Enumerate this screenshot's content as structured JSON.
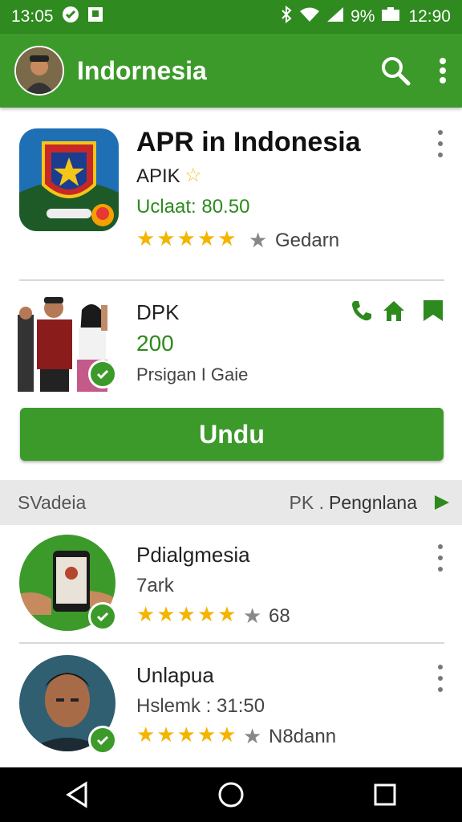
{
  "status_bar": {
    "time_left": "13:05",
    "battery": "9%",
    "time_right": "12:90"
  },
  "app_bar": {
    "title": "Indornesia"
  },
  "featured": {
    "title": "APR in Indonesia",
    "publisher": "APIK",
    "update": "Uclaat: 80.50",
    "rating": 5,
    "category": "Gedarn"
  },
  "promo": {
    "name": "DPK",
    "count": "200",
    "caption": "Prsigan I Gaie"
  },
  "install_button": {
    "label": "Undu"
  },
  "section": {
    "left_label": "SVadeia",
    "right_prefix": "PK .",
    "right_label": "Pengnlana"
  },
  "list": [
    {
      "title": "Pdialgmesia",
      "subtitle": "7ark",
      "rating": 5,
      "meta": "68"
    },
    {
      "title": "Unlapua",
      "subtitle": "Hslemk : 31:50",
      "rating": 5,
      "meta": "N8dann"
    }
  ],
  "colors": {
    "primary": "#3c9a2a",
    "status_bar": "#2f8a1f",
    "star": "#f4b400"
  }
}
